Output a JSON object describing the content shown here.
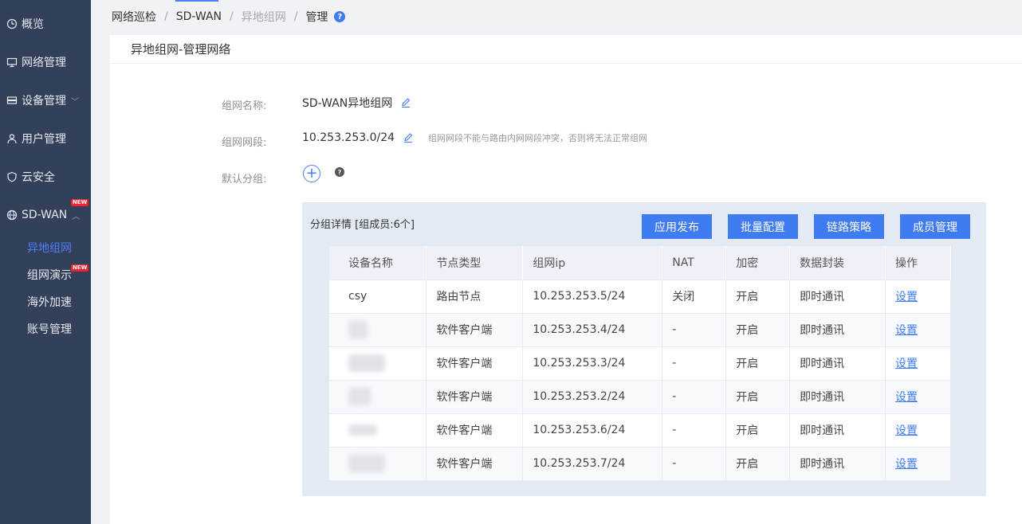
{
  "sidebar": {
    "items": [
      {
        "label": "概览",
        "icon": "clock-icon"
      },
      {
        "label": "网络管理",
        "icon": "monitor-icon"
      },
      {
        "label": "设备管理",
        "icon": "server-icon",
        "expandable": true
      },
      {
        "label": "用户管理",
        "icon": "user-icon"
      },
      {
        "label": "云安全",
        "icon": "shield-icon"
      },
      {
        "label": "SD-WAN",
        "icon": "globe-icon",
        "expanded": true,
        "badge": "NEW"
      }
    ],
    "subitems": [
      {
        "label": "异地组网",
        "active": true
      },
      {
        "label": "组网演示",
        "badge": "NEW"
      },
      {
        "label": "海外加速"
      },
      {
        "label": "账号管理"
      }
    ]
  },
  "breadcrumb": [
    "网络巡检",
    "SD-WAN",
    "异地组网",
    "管理"
  ],
  "panel": {
    "title": "异地组网-管理网络",
    "form": {
      "name_label": "组网名称:",
      "name_value": "SD-WAN异地组网",
      "segment_label": "组网网段:",
      "segment_value": "10.253.253.0/24",
      "segment_hint": "组网网段不能与路由内网网段冲突，否则将无法正常组网",
      "default_group_label": "默认分组:"
    },
    "group": {
      "title": "分组详情 [组成员:6个]",
      "buttons": [
        "应用发布",
        "批量配置",
        "链路策略",
        "成员管理"
      ],
      "columns": [
        "设备名称",
        "节点类型",
        "组网ip",
        "NAT",
        "加密",
        "数据封装",
        "操作"
      ],
      "rows": [
        {
          "name": "csy",
          "type": "路由节点",
          "ip": "10.253.253.5/24",
          "nat": "关闭",
          "enc": "开启",
          "pack": "即时通讯",
          "op": "设置"
        },
        {
          "name": "",
          "type": "软件客户端",
          "ip": "10.253.253.4/24",
          "nat": "-",
          "enc": "开启",
          "pack": "即时通讯",
          "op": "设置"
        },
        {
          "name": "",
          "type": "软件客户端",
          "ip": "10.253.253.3/24",
          "nat": "-",
          "enc": "开启",
          "pack": "即时通讯",
          "op": "设置"
        },
        {
          "name": "",
          "type": "软件客户端",
          "ip": "10.253.253.2/24",
          "nat": "-",
          "enc": "开启",
          "pack": "即时通讯",
          "op": "设置"
        },
        {
          "name": "",
          "type": "软件客户端",
          "ip": "10.253.253.6/24",
          "nat": "-",
          "enc": "开启",
          "pack": "即时通讯",
          "op": "设置"
        },
        {
          "name": "",
          "type": "软件客户端",
          "ip": "10.253.253.7/24",
          "nat": "-",
          "enc": "开启",
          "pack": "即时通讯",
          "op": "设置"
        }
      ]
    }
  },
  "colors": {
    "accent": "#3f7cf2",
    "sidebar": "#33405a",
    "badge": "#f5222d"
  }
}
